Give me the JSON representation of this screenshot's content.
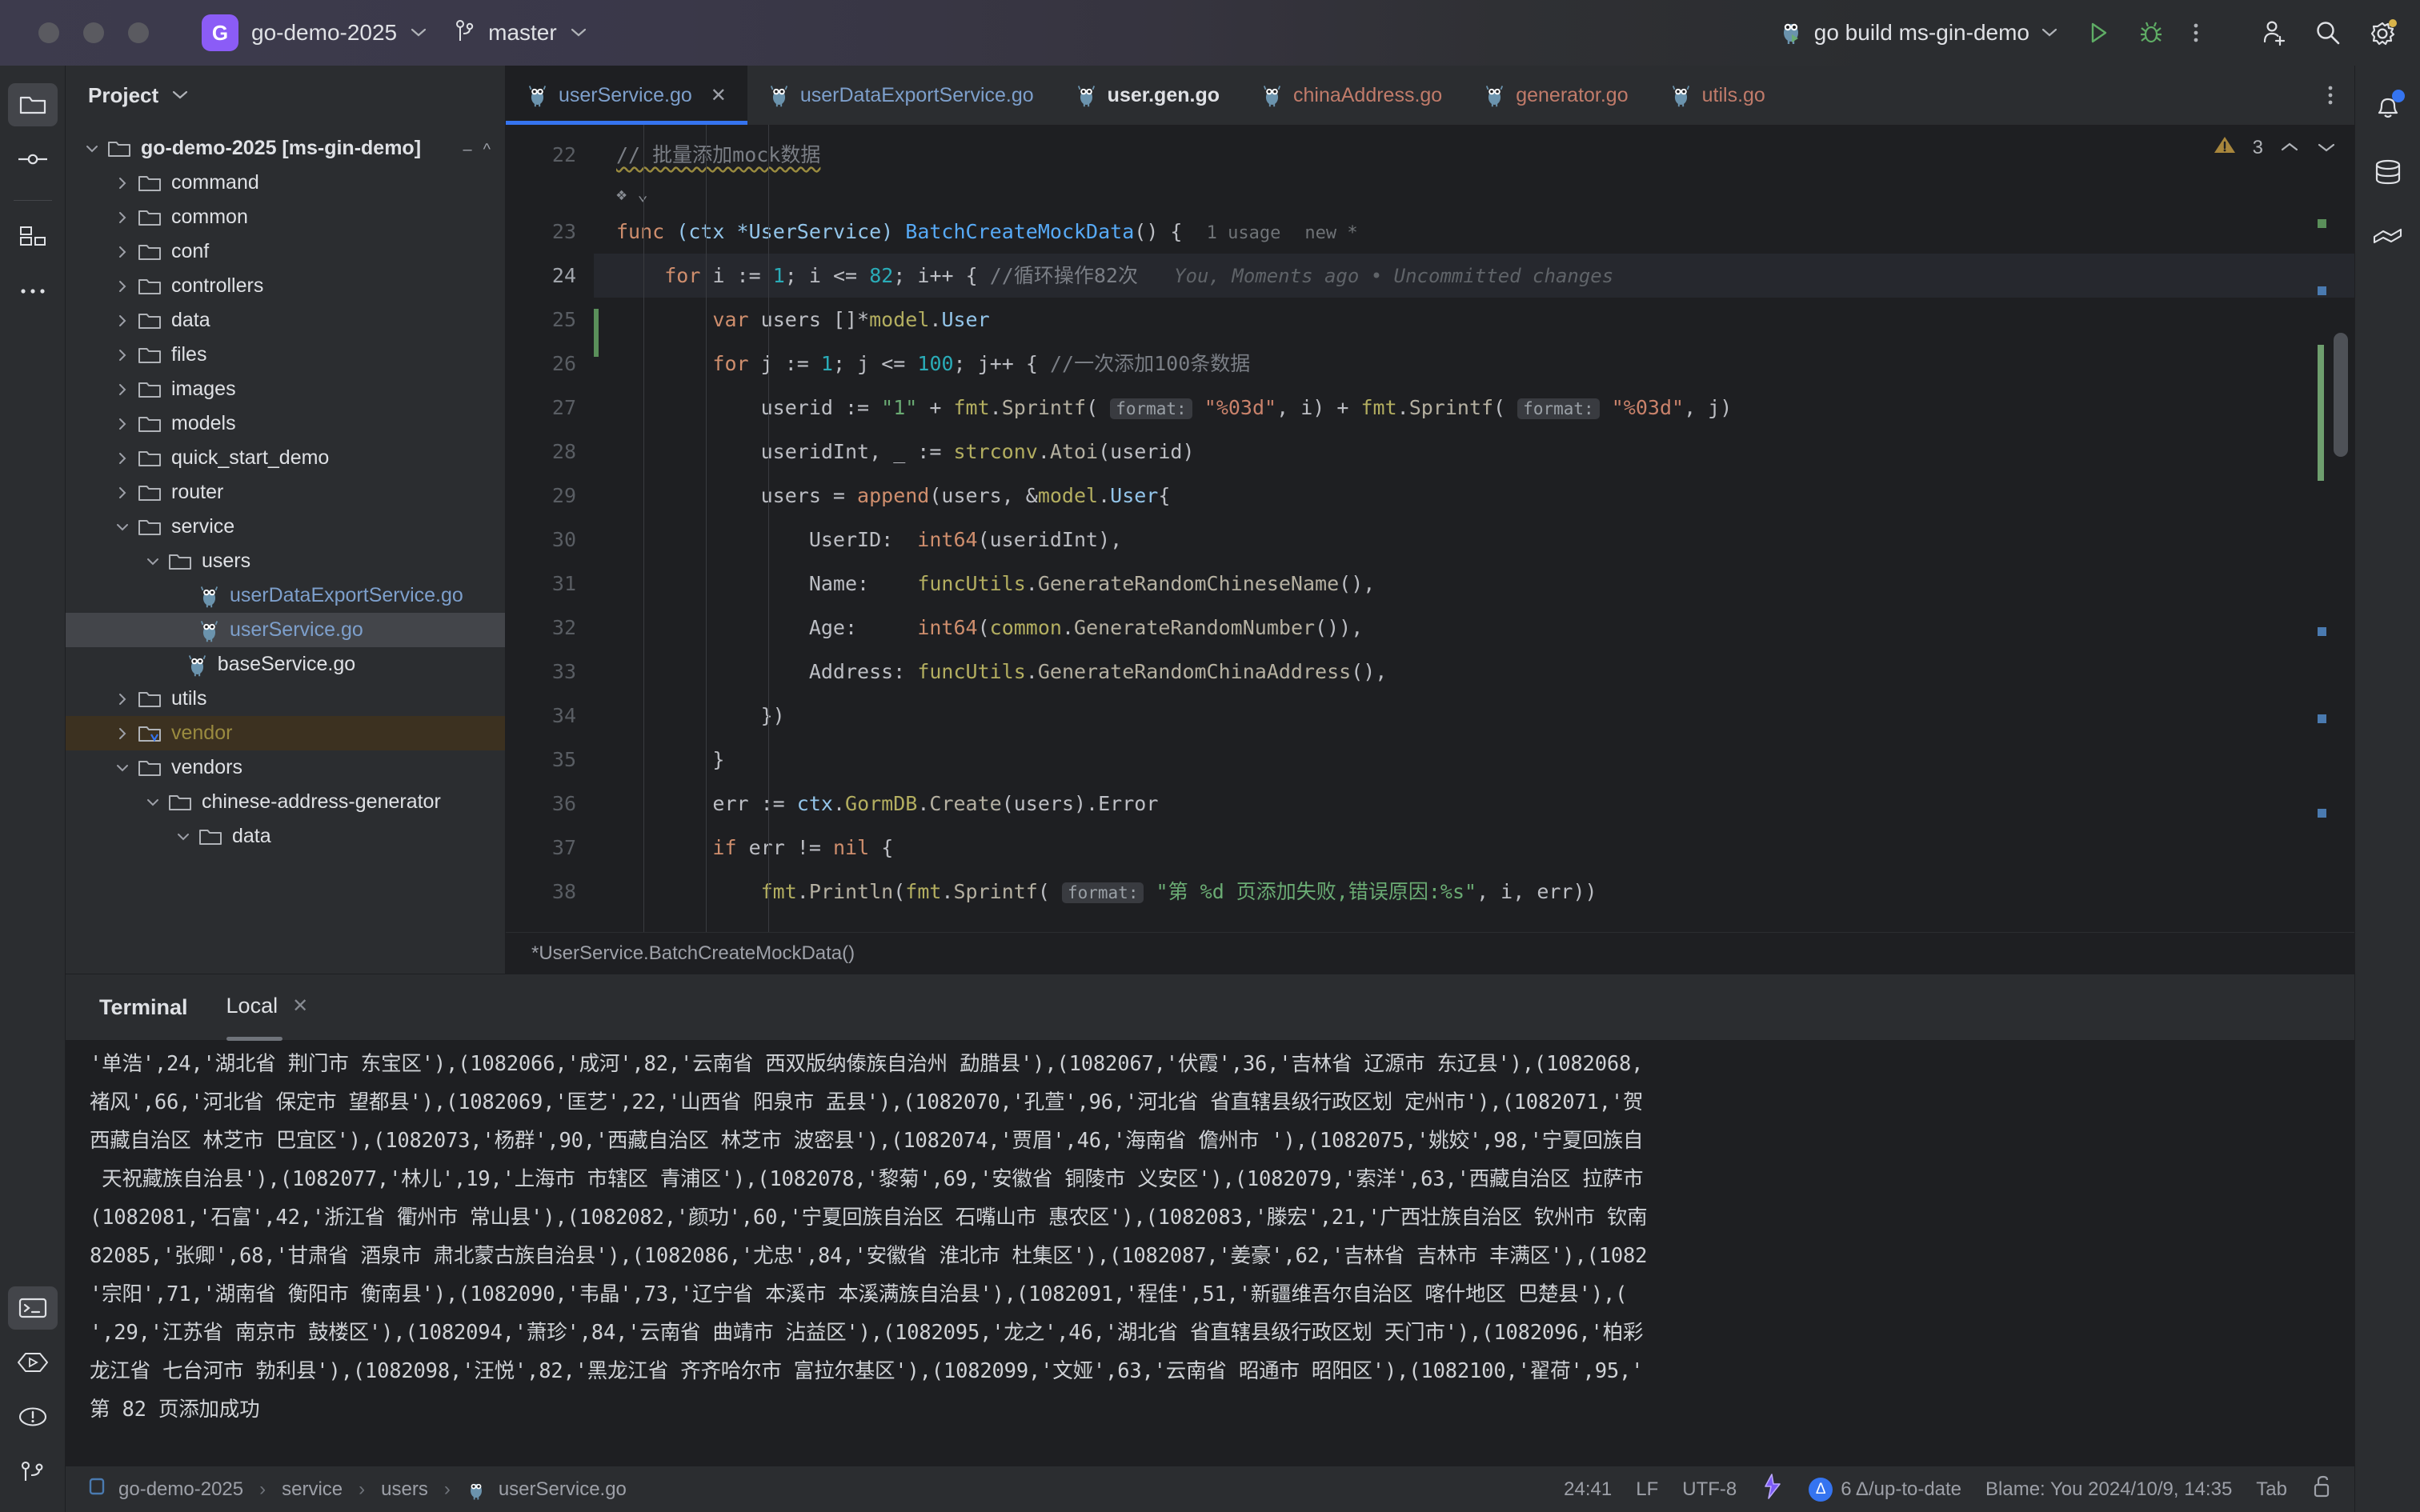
{
  "titlebar": {
    "project_badge": "G",
    "project_name": "go-demo-2025",
    "branch": "master",
    "run_config": "go build ms-gin-demo",
    "icons": {
      "run": "run-icon",
      "debug": "debug-icon",
      "more": "more-options-icon",
      "add_user": "add-user-icon",
      "search": "search-icon",
      "settings": "settings-icon",
      "gopher": "go-gopher-icon"
    }
  },
  "activitybar": {
    "top": [
      {
        "name": "project-icon",
        "label": "Project",
        "active": true
      },
      {
        "name": "commit-icon",
        "label": "Commit",
        "active": false
      },
      {
        "name": "structure-icon",
        "label": "Structure",
        "active": false
      },
      {
        "name": "more-tool-windows-icon",
        "label": "More Tool Windows",
        "active": false
      }
    ],
    "bottom": [
      {
        "name": "terminal-icon",
        "label": "Terminal",
        "active": true
      },
      {
        "name": "run-icon",
        "label": "Run",
        "active": false
      },
      {
        "name": "problems-icon",
        "label": "Problems",
        "active": false
      },
      {
        "name": "version-control-icon",
        "label": "Version Control",
        "active": false
      }
    ]
  },
  "project_panel": {
    "title": "Project",
    "tree": [
      {
        "label": "go-demo-2025 [ms-gin-demo]",
        "depth": 0,
        "kind": "folder",
        "arrow": "down",
        "bold": true
      },
      {
        "label": "command",
        "depth": 1,
        "kind": "folder",
        "arrow": "right"
      },
      {
        "label": "common",
        "depth": 1,
        "kind": "folder",
        "arrow": "right"
      },
      {
        "label": "conf",
        "depth": 1,
        "kind": "folder",
        "arrow": "right"
      },
      {
        "label": "controllers",
        "depth": 1,
        "kind": "folder",
        "arrow": "right"
      },
      {
        "label": "data",
        "depth": 1,
        "kind": "folder",
        "arrow": "right"
      },
      {
        "label": "files",
        "depth": 1,
        "kind": "folder",
        "arrow": "right"
      },
      {
        "label": "images",
        "depth": 1,
        "kind": "folder",
        "arrow": "right"
      },
      {
        "label": "models",
        "depth": 1,
        "kind": "folder",
        "arrow": "right"
      },
      {
        "label": "quick_start_demo",
        "depth": 1,
        "kind": "folder",
        "arrow": "right"
      },
      {
        "label": "router",
        "depth": 1,
        "kind": "folder",
        "arrow": "right"
      },
      {
        "label": "service",
        "depth": 1,
        "kind": "folder",
        "arrow": "down"
      },
      {
        "label": "users",
        "depth": 2,
        "kind": "folder",
        "arrow": "down"
      },
      {
        "label": "userDataExportService.go",
        "depth": 3,
        "kind": "go",
        "color": "blue"
      },
      {
        "label": "userService.go",
        "depth": 3,
        "kind": "go",
        "color": "blue",
        "selected": true
      },
      {
        "label": "baseService.go",
        "depth": 2.6,
        "kind": "go",
        "color": "white"
      },
      {
        "label": "utils",
        "depth": 1,
        "kind": "folder",
        "arrow": "right"
      },
      {
        "label": "vendor",
        "depth": 1,
        "kind": "folder",
        "arrow": "right",
        "excluded": true
      },
      {
        "label": "vendors",
        "depth": 1,
        "kind": "folder",
        "arrow": "down"
      },
      {
        "label": "chinese-address-generator",
        "depth": 2,
        "kind": "folder",
        "arrow": "down"
      },
      {
        "label": "data",
        "depth": 3,
        "kind": "folder",
        "arrow": "down"
      }
    ]
  },
  "editor": {
    "tabs": [
      {
        "label": "userService.go",
        "color": "blue",
        "active": true,
        "closable": true
      },
      {
        "label": "userDataExportService.go",
        "color": "blue",
        "active": false
      },
      {
        "label": "user.gen.go",
        "color": "white",
        "active": false
      },
      {
        "label": "chinaAddress.go",
        "color": "salmon",
        "active": false
      },
      {
        "label": "generator.go",
        "color": "salmon",
        "active": false
      },
      {
        "label": "utils.go",
        "color": "salmon",
        "active": false
      }
    ],
    "inspection": {
      "warning_count": "3",
      "warn_icon": "warning-triangle-icon"
    },
    "breadcrumb": "*UserService.BatchCreateMockData()",
    "line_numbers": [
      "22",
      "23",
      "24",
      "25",
      "26",
      "27",
      "28",
      "29",
      "30",
      "31",
      "32",
      "33",
      "34",
      "35",
      "36",
      "37",
      "38"
    ],
    "code": {
      "l22_comment": "// 批量添加mock数据",
      "l23_func": "func",
      "l23_recv": "(ctx *UserService)",
      "l23_name": "BatchCreateMockData",
      "l23_tail": "() {",
      "l23_usage": "1 usage",
      "l23_new": "new *",
      "l24_text": "for i := 1; i <= 82; i++ { //循环操作82次",
      "l24_blame": "You, Moments ago • Uncommitted changes",
      "l25_text": "var users []*model.User",
      "l26_text": "for j := 1; j <= 100; j++ { //一次添加100条数据",
      "l27_text": "userid := \"1\" + fmt.Sprintf( format: \"%03d\", i) + fmt.Sprintf( format: \"%03d\", j)",
      "l28_text": "useridInt, _ := strconv.Atoi(userid)",
      "l29_text": "users = append(users, &model.User{",
      "l30_text": "UserID:  int64(useridInt),",
      "l31_text": "Name:    funcUtils.GenerateRandomChineseName(),",
      "l32_text": "Age:     int64(common.GenerateRandomNumber()),",
      "l33_text": "Address: funcUtils.GenerateRandomChinaAddress(),",
      "l34_text": "})",
      "l35_text": "}",
      "l36_text": "err := ctx.GormDB.Create(users).Error",
      "l37_text": "if err != nil {",
      "l38_text": "fmt.Println(fmt.Sprintf( format: \"第 %d 页添加失败,错误原因:%s\", i, err))"
    }
  },
  "terminal": {
    "title": "Terminal",
    "tab_label": "Local",
    "close_icon": "close-icon",
    "lines": [
      "'单浩',24,'湖北省 荆门市 东宝区'),(1082066,'成河',82,'云南省 西双版纳傣族自治州 勐腊县'),(1082067,'伏霞',36,'吉林省 辽源市 东辽县'),(1082068,",
      "褚风',66,'河北省 保定市 望都县'),(1082069,'匡艺',22,'山西省 阳泉市 盂县'),(1082070,'孔萱',96,'河北省 省直辖县级行政区划 定州市'),(1082071,'贺",
      "西藏自治区 林芝市 巴宜区'),(1082073,'杨群',90,'西藏自治区 林芝市 波密县'),(1082074,'贾眉',46,'海南省 儋州市 '),(1082075,'姚姣',98,'宁夏回族自",
      " 天祝藏族自治县'),(1082077,'林儿',19,'上海市 市辖区 青浦区'),(1082078,'黎菊',69,'安徽省 铜陵市 义安区'),(1082079,'索洋',63,'西藏自治区 拉萨市",
      "(1082081,'石富',42,'浙江省 衢州市 常山县'),(1082082,'颜功',60,'宁夏回族自治区 石嘴山市 惠农区'),(1082083,'滕宏',21,'广西壮族自治区 钦州市 钦南",
      "82085,'张卿',68,'甘肃省 酒泉市 肃北蒙古族自治县'),(1082086,'尤忠',84,'安徽省 淮北市 杜集区'),(1082087,'姜豪',62,'吉林省 吉林市 丰满区'),(1082",
      "'宗阳',71,'湖南省 衡阳市 衡南县'),(1082090,'韦晶',73,'辽宁省 本溪市 本溪满族自治县'),(1082091,'程佳',51,'新疆维吾尔自治区 喀什地区 巴楚县'),(",
      "',29,'江苏省 南京市 鼓楼区'),(1082094,'萧珍',84,'云南省 曲靖市 沾益区'),(1082095,'龙之',46,'湖北省 省直辖县级行政区划 天门市'),(1082096,'柏彩",
      "龙江省 七台河市 勃利县'),(1082098,'汪悦',82,'黑龙江省 齐齐哈尔市 富拉尔基区'),(1082099,'文娅',63,'云南省 昭通市 昭阳区'),(1082100,'翟荷',95,'",
      "第 82 页添加成功"
    ]
  },
  "statusbar": {
    "breadcrumb": [
      {
        "label": "go-demo-2025",
        "icon": "module-icon"
      },
      {
        "label": "service"
      },
      {
        "label": "users"
      },
      {
        "label": "userService.go",
        "icon": "go-gopher-icon"
      }
    ],
    "caret": "24:41",
    "line_sep": "LF",
    "encoding": "UTF-8",
    "ai_icon": "ai-assistant-icon",
    "vcs_status": "6 Δ/up-to-date",
    "vcs_badge": "Δ",
    "blame": "Blame: You 2024/10/9, 14:35",
    "indent": "Tab",
    "lock_icon": "lock-icon"
  },
  "rightbar": {
    "icons": [
      {
        "name": "notifications-icon",
        "label": "Notifications",
        "dot": true
      },
      {
        "name": "database-icon",
        "label": "Database"
      },
      {
        "name": "plugins-icon",
        "label": "Plugins"
      }
    ]
  },
  "colors": {
    "accent": "#3574f0",
    "badge": "#8b5cf6",
    "warning": "#a8863c",
    "excluded": "#9a8b3f",
    "editor_bg": "#1e1f22",
    "panel_bg": "#2b2d30"
  }
}
